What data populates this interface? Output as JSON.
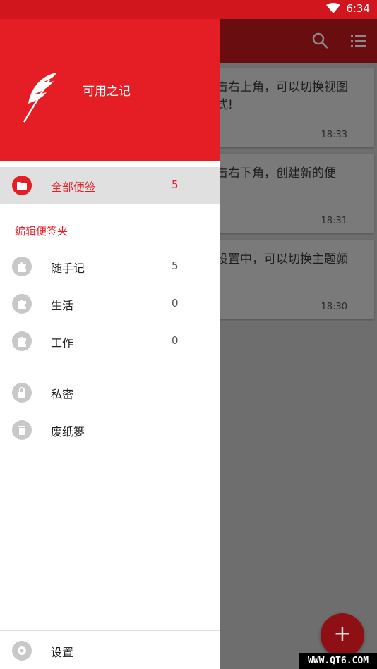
{
  "status_bar": {
    "time": "6:34",
    "wifi_icon": "wifi-icon",
    "color": "#d1161d"
  },
  "toolbar": {
    "search_icon": "search-icon",
    "list_icon": "list-icon"
  },
  "notes": [
    {
      "text": "击右上角，可以切换视图\n式!",
      "time": "18:33"
    },
    {
      "text": "击右下角，创建新的便",
      "time": "18:31"
    },
    {
      "text": "设置中，可以切换主题颜",
      "time": "18:30"
    }
  ],
  "fab": {
    "label": "+"
  },
  "drawer": {
    "app_name": "可用之记",
    "accent": "#e41e24",
    "all_notes": {
      "label": "全部便签",
      "count": "5"
    },
    "section_title": "编辑便签夹",
    "folders": [
      {
        "label": "随手记",
        "count": "5"
      },
      {
        "label": "生活",
        "count": "0"
      },
      {
        "label": "工作",
        "count": "0"
      }
    ],
    "private": {
      "label": "私密"
    },
    "trash": {
      "label": "废纸篓"
    },
    "settings": {
      "label": "设置"
    }
  },
  "watermark": "WWW.QT6.COM"
}
